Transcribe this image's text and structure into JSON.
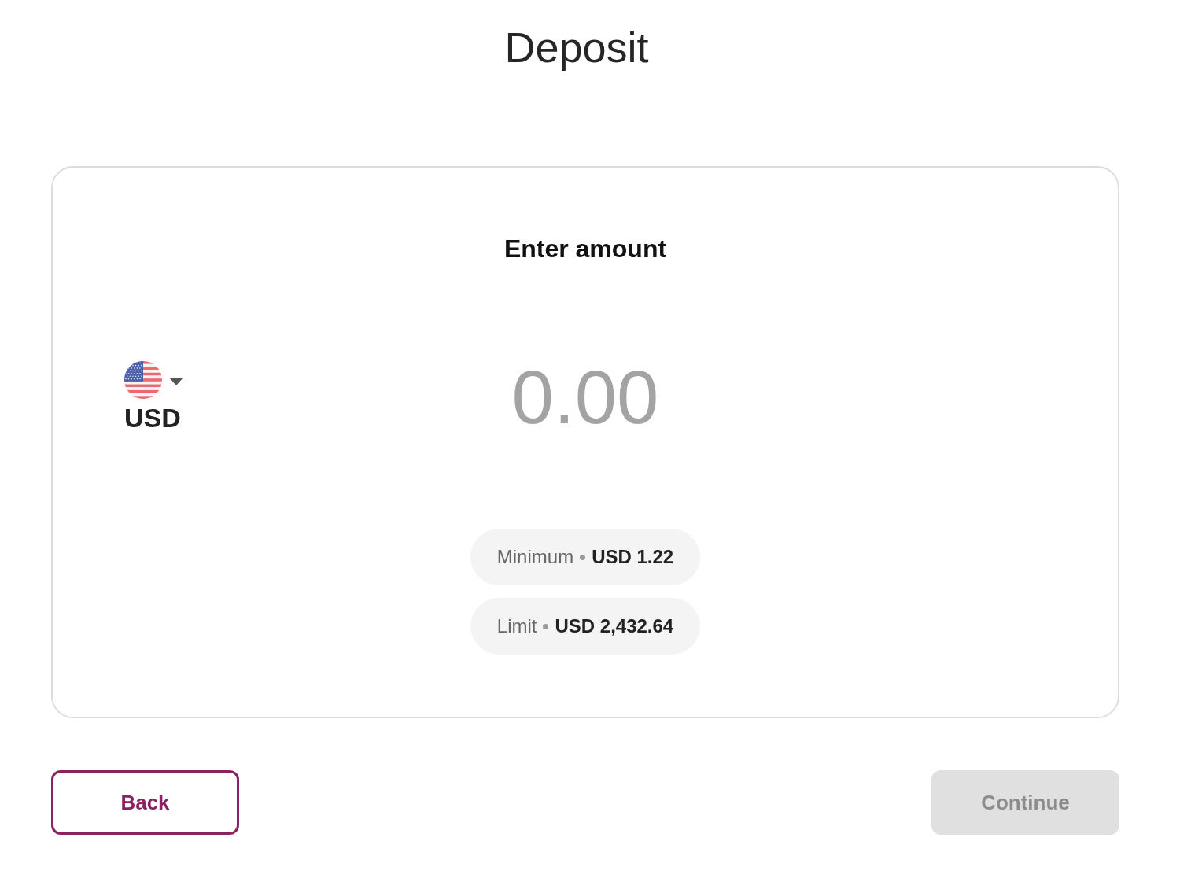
{
  "page": {
    "title": "Deposit"
  },
  "amount_card": {
    "heading": "Enter amount",
    "currency": {
      "code": "USD"
    },
    "amount_field": {
      "placeholder": "0.00"
    },
    "limits": [
      {
        "label": "Minimum",
        "value": "USD 1.22"
      },
      {
        "label": "Limit",
        "value": "USD 2,432.64"
      }
    ]
  },
  "buttons": [
    {
      "label": "Back",
      "kind": "secondary",
      "disabled": false
    },
    {
      "label": "Continue",
      "kind": "primary",
      "disabled": true
    }
  ]
}
